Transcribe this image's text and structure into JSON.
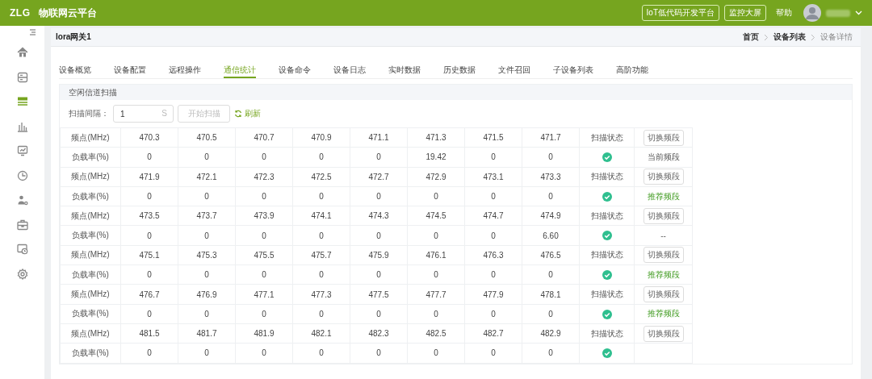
{
  "header": {
    "logo": "ZLG",
    "title": "物联网云平台",
    "buttons": [
      "IoT低代码开发平台",
      "监控大屏"
    ],
    "help": "帮助"
  },
  "sidebar": {
    "items": [
      {
        "kind": "home",
        "selected": false
      },
      {
        "kind": "storage",
        "selected": false
      },
      {
        "kind": "list",
        "selected": true
      },
      {
        "kind": "chart",
        "selected": false
      },
      {
        "kind": "monitor",
        "selected": false
      },
      {
        "kind": "clock",
        "selected": false
      },
      {
        "kind": "user",
        "selected": false
      },
      {
        "kind": "toolbox",
        "selected": false
      },
      {
        "kind": "screen",
        "selected": false
      },
      {
        "kind": "gear",
        "selected": false
      }
    ]
  },
  "page": {
    "title": "lora网关1",
    "breadcrumb": [
      {
        "label": "首页",
        "current": false
      },
      {
        "label": "设备列表",
        "current": false
      },
      {
        "label": "设备详情",
        "current": true
      }
    ]
  },
  "tabs": [
    {
      "label": "设备概览",
      "selected": false
    },
    {
      "label": "设备配置",
      "selected": false
    },
    {
      "label": "远程操作",
      "selected": false
    },
    {
      "label": "通信统计",
      "selected": true
    },
    {
      "label": "设备命令",
      "selected": false
    },
    {
      "label": "设备日志",
      "selected": false
    },
    {
      "label": "实时数据",
      "selected": false
    },
    {
      "label": "历史数据",
      "selected": false
    },
    {
      "label": "文件召回",
      "selected": false
    },
    {
      "label": "子设备列表",
      "selected": false
    },
    {
      "label": "高阶功能",
      "selected": false
    }
  ],
  "scan": {
    "title": "空闲信道扫描",
    "interval_label": "扫描间隔：",
    "interval_value": "1",
    "unit": "S",
    "start_button": "开始扫描",
    "start_disabled": true,
    "refresh": "刷新"
  },
  "groups": [
    {
      "freq_label": "频点(MHz)",
      "freqs": [
        "470.3",
        "470.5",
        "470.7",
        "470.9",
        "471.1",
        "471.3",
        "471.5",
        "471.7"
      ],
      "status_label": "扫描状态",
      "switch_button": "切换频段",
      "load_label": "负载率(%)",
      "loads": [
        "0",
        "0",
        "0",
        "0",
        "0",
        "19.42",
        "0",
        "0"
      ],
      "scanned": true,
      "band_note": {
        "kind": "current",
        "text": "当前频段"
      }
    },
    {
      "freq_label": "频点(MHz)",
      "freqs": [
        "471.9",
        "472.1",
        "472.3",
        "472.5",
        "472.7",
        "472.9",
        "473.1",
        "473.3"
      ],
      "status_label": "扫描状态",
      "switch_button": "切换频段",
      "load_label": "负载率(%)",
      "loads": [
        "0",
        "0",
        "0",
        "0",
        "0",
        "0",
        "0",
        "0"
      ],
      "scanned": true,
      "band_note": {
        "kind": "recommended",
        "text": "推荐频段"
      }
    },
    {
      "freq_label": "频点(MHz)",
      "freqs": [
        "473.5",
        "473.7",
        "473.9",
        "474.1",
        "474.3",
        "474.5",
        "474.7",
        "474.9"
      ],
      "status_label": "扫描状态",
      "switch_button": "切换频段",
      "load_label": "负载率(%)",
      "loads": [
        "0",
        "0",
        "0",
        "0",
        "0",
        "0",
        "0",
        "6.60"
      ],
      "scanned": true,
      "band_note": {
        "kind": "none",
        "text": "--"
      }
    },
    {
      "freq_label": "频点(MHz)",
      "freqs": [
        "475.1",
        "475.3",
        "475.5",
        "475.7",
        "475.9",
        "476.1",
        "476.3",
        "476.5"
      ],
      "status_label": "扫描状态",
      "switch_button": "切换频段",
      "load_label": "负载率(%)",
      "loads": [
        "0",
        "0",
        "0",
        "0",
        "0",
        "0",
        "0",
        "0"
      ],
      "scanned": true,
      "band_note": {
        "kind": "recommended",
        "text": "推荐频段"
      }
    },
    {
      "freq_label": "频点(MHz)",
      "freqs": [
        "476.7",
        "476.9",
        "477.1",
        "477.3",
        "477.5",
        "477.7",
        "477.9",
        "478.1"
      ],
      "status_label": "扫描状态",
      "switch_button": "切换频段",
      "load_label": "负载率(%)",
      "loads": [
        "0",
        "0",
        "0",
        "0",
        "0",
        "0",
        "0",
        "0"
      ],
      "scanned": true,
      "band_note": {
        "kind": "recommended",
        "text": "推荐频段"
      }
    },
    {
      "freq_label": "频点(MHz)",
      "freqs": [
        "481.5",
        "481.7",
        "481.9",
        "482.1",
        "482.3",
        "482.5",
        "482.7",
        "482.9"
      ],
      "status_label": "扫描状态",
      "switch_button": "切换频段",
      "load_label": "负载率(%)",
      "loads": [
        "0",
        "0",
        "0",
        "0",
        "0",
        "0",
        "0",
        "0"
      ],
      "scanned": true
    }
  ]
}
